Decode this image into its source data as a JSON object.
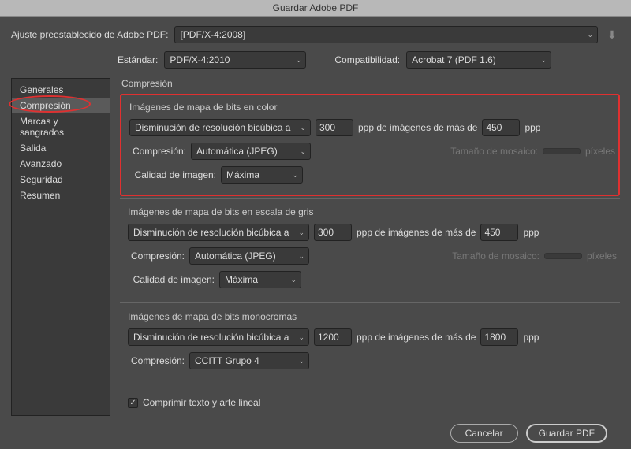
{
  "window": {
    "title": "Guardar Adobe PDF"
  },
  "header": {
    "preset_label": "Ajuste preestablecido de Adobe PDF:",
    "preset_value": "[PDF/X-4:2008]",
    "standard_label": "Estándar:",
    "standard_value": "PDF/X-4:2010",
    "compat_label": "Compatibilidad:",
    "compat_value": "Acrobat 7 (PDF 1.6)"
  },
  "sidebar": {
    "items": [
      "Generales",
      "Compresión",
      "Marcas y sangrados",
      "Salida",
      "Avanzado",
      "Seguridad",
      "Resumen"
    ]
  },
  "panel": {
    "title": "Compresión",
    "color": {
      "title": "Imágenes de mapa de bits en color",
      "downsample": "Disminución de resolución bicúbica a",
      "dpi_value": "300",
      "ppp_label1": "ppp de imágenes de más de",
      "dpi_threshold": "450",
      "ppp_label2": "ppp",
      "compression_label": "Compresión:",
      "compression_value": "Automática (JPEG)",
      "tile_label": "Tamaño de mosaico:",
      "tile_value": "",
      "tile_unit": "píxeles",
      "quality_label": "Calidad de imagen:",
      "quality_value": "Máxima"
    },
    "gray": {
      "title": "Imágenes de mapa de bits en escala de gris",
      "downsample": "Disminución de resolución bicúbica a",
      "dpi_value": "300",
      "ppp_label1": "ppp de imágenes de más de",
      "dpi_threshold": "450",
      "ppp_label2": "ppp",
      "compression_label": "Compresión:",
      "compression_value": "Automática (JPEG)",
      "tile_label": "Tamaño de mosaico:",
      "tile_value": "",
      "tile_unit": "píxeles",
      "quality_label": "Calidad de imagen:",
      "quality_value": "Máxima"
    },
    "mono": {
      "title": "Imágenes de mapa de bits monocromas",
      "downsample": "Disminución de resolución bicúbica a",
      "dpi_value": "1200",
      "ppp_label1": "ppp de imágenes de más de",
      "dpi_threshold": "1800",
      "ppp_label2": "ppp",
      "compression_label": "Compresión:",
      "compression_value": "CCITT Grupo 4"
    },
    "compress_text_label": "Comprimir texto y arte lineal"
  },
  "footer": {
    "cancel": "Cancelar",
    "save": "Guardar PDF"
  }
}
